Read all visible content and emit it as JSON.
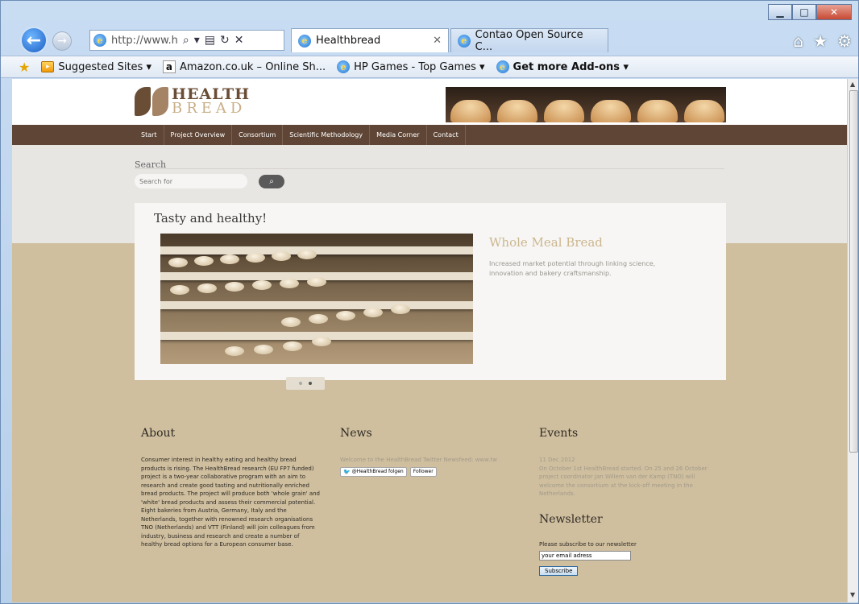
{
  "browser": {
    "address": "http://www.h",
    "tabs": [
      {
        "label": "Healthbread",
        "active": true
      },
      {
        "label": "Contao Open Source C...",
        "active": false
      }
    ],
    "favorites": [
      {
        "label": "Suggested Sites ▾",
        "icon": "suggested-icon"
      },
      {
        "label": "Amazon.co.uk – Online Sh...",
        "icon": "amazon-icon"
      },
      {
        "label": "HP Games - Top Games ▾",
        "icon": "ie-page-icon"
      },
      {
        "label": "Get more Add-ons ▾",
        "icon": "ie-page-icon"
      }
    ]
  },
  "site": {
    "logo": {
      "line1": "HEALTH",
      "line2": "BREAD"
    },
    "menu": [
      "Start",
      "Project Overview",
      "Consortium",
      "Scientific Methodology",
      "Media Corner",
      "Contact"
    ],
    "search": {
      "label": "Search",
      "placeholder": "Search for"
    },
    "slider": {
      "title": "Tasty and healthy!",
      "heading": "Whole Meal Bread",
      "text": "Increased market potential through linking science, innovation and bakery craftsmanship."
    },
    "about": {
      "title": "About",
      "text": "Consumer interest in healthy eating and healthy bread products is rising. The HealthBread research (EU FP7 funded) project is a two-year collaborative program with an aim to research and create good tasting and nutritionally enriched bread products. The project will produce both 'whole grain' and 'white' bread products and assess their commercial potential. Eight bakeries from Austria, Germany, Italy and the Netherlands, together with renowned research organisations TNO (Netherlands) and VTT (Finland) will join colleagues from industry, business and research and create a number of healthy bread options for a European consumer base."
    },
    "news": {
      "title": "News",
      "text": "Welcome to the HealthBread Twitter Newsfeed: www.tw",
      "twitter_handle": "@HealthBread folgen",
      "followers": "Follower"
    },
    "events": {
      "title": "Events",
      "date": "11 Dec 2012",
      "text": "On October 1st HealthBread started. On 25 and 26 October project coordinator Jan Willem van der Kamp (TNO) will welcome the consortium at the kick-off meeting in the Netherlands."
    },
    "newsletter": {
      "title": "Newsletter",
      "prompt": "Please subscribe to our newsletter",
      "input_value": "your email adress",
      "button": "Subscribe"
    }
  }
}
